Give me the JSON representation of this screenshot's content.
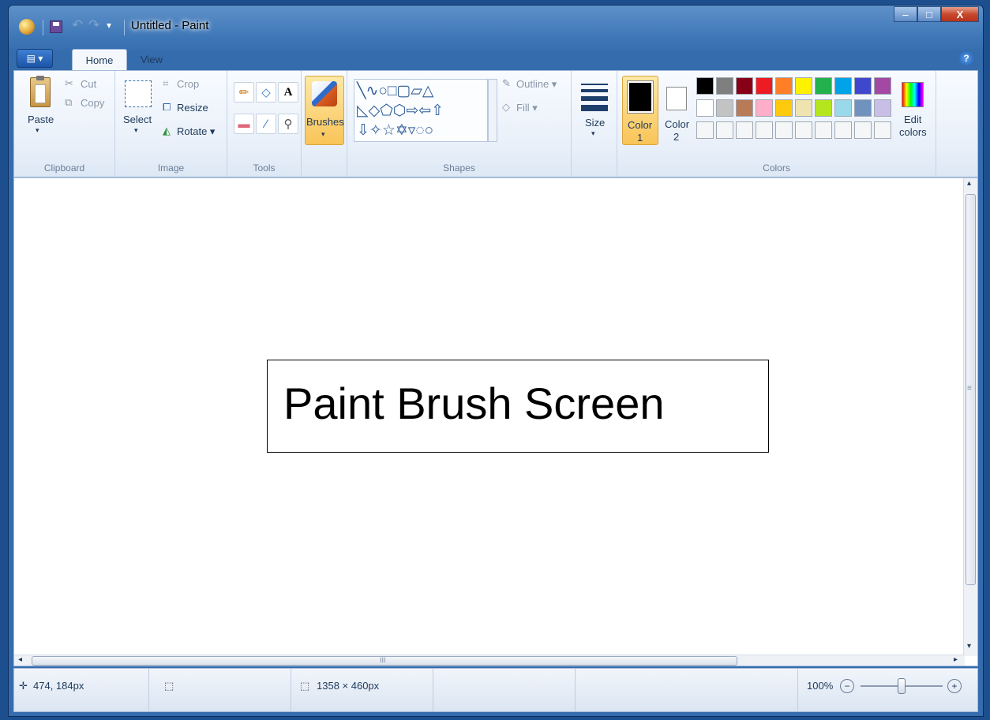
{
  "window": {
    "title": "Untitled - Paint",
    "min": "‒",
    "max": "□",
    "close": "X"
  },
  "quick_access": {
    "menu_arrow": "▾",
    "undo": "↶",
    "redo": "↷"
  },
  "app_menu": "▤ ▾",
  "tabs": {
    "home": "Home",
    "view": "View",
    "help": "?"
  },
  "clipboard": {
    "paste": "Paste",
    "cut": "Cut",
    "copy": "Copy",
    "label": "Clipboard",
    "arrow": "▾"
  },
  "image": {
    "select": "Select",
    "crop": "Crop",
    "resize": "Resize",
    "rotate": "Rotate ▾",
    "label": "Image",
    "arrow": "▾"
  },
  "tools": {
    "label": "Tools",
    "text_tool": "A",
    "pencil": "✏",
    "fill": "◇",
    "eraser": "▬",
    "picker": "∕",
    "magnifier": "⚲"
  },
  "brushes": {
    "label": "Brushes",
    "arrow": "▾"
  },
  "shapes": {
    "label": "Shapes",
    "outline": "Outline ▾",
    "fill": "Fill ▾",
    "row1": "╲∿○□▢▱△",
    "row2": "◺◇⬠⬡⇨⇦⇧",
    "row3": "⇩✧☆✡▿◌○"
  },
  "size": {
    "label": "Size",
    "arrow": "▾"
  },
  "color1": {
    "label": "Color",
    "num": "1"
  },
  "color2": {
    "label": "Color",
    "num": "2"
  },
  "colors": {
    "label": "Colors",
    "edit": "Edit",
    "edit2": "colors",
    "row1": [
      "#000000",
      "#7f7f7f",
      "#880015",
      "#ed1c24",
      "#ff7f27",
      "#fff200",
      "#22b14c",
      "#00a2e8",
      "#3f48cc",
      "#a349a4"
    ],
    "row2": [
      "#ffffff",
      "#c3c3c3",
      "#b97a57",
      "#ffaec9",
      "#ffc90e",
      "#efe4b0",
      "#b5e61d",
      "#99d9ea",
      "#7092be",
      "#c8bfe7"
    ],
    "row3": [
      "#f5f6f7",
      "#f5f6f7",
      "#f5f6f7",
      "#f5f6f7",
      "#f5f6f7",
      "#f5f6f7",
      "#f5f6f7",
      "#f5f6f7",
      "#f5f6f7",
      "#f5f6f7"
    ]
  },
  "canvas": {
    "caption": "Paint Brush Screen"
  },
  "scroll": {
    "grip": "III",
    "up": "▴",
    "down": "▾",
    "left": "◂",
    "right": "▸",
    "vgrip": "≡"
  },
  "status": {
    "cursor": "474, 184px",
    "selection": "",
    "canvas_size": "1358 × 460px",
    "zoom": "100%",
    "zoom_level": 1.0,
    "move_icon": "✛",
    "minus": "−",
    "plus": "+",
    "sel_icon": "⬚",
    "size_icon": "⬚"
  }
}
